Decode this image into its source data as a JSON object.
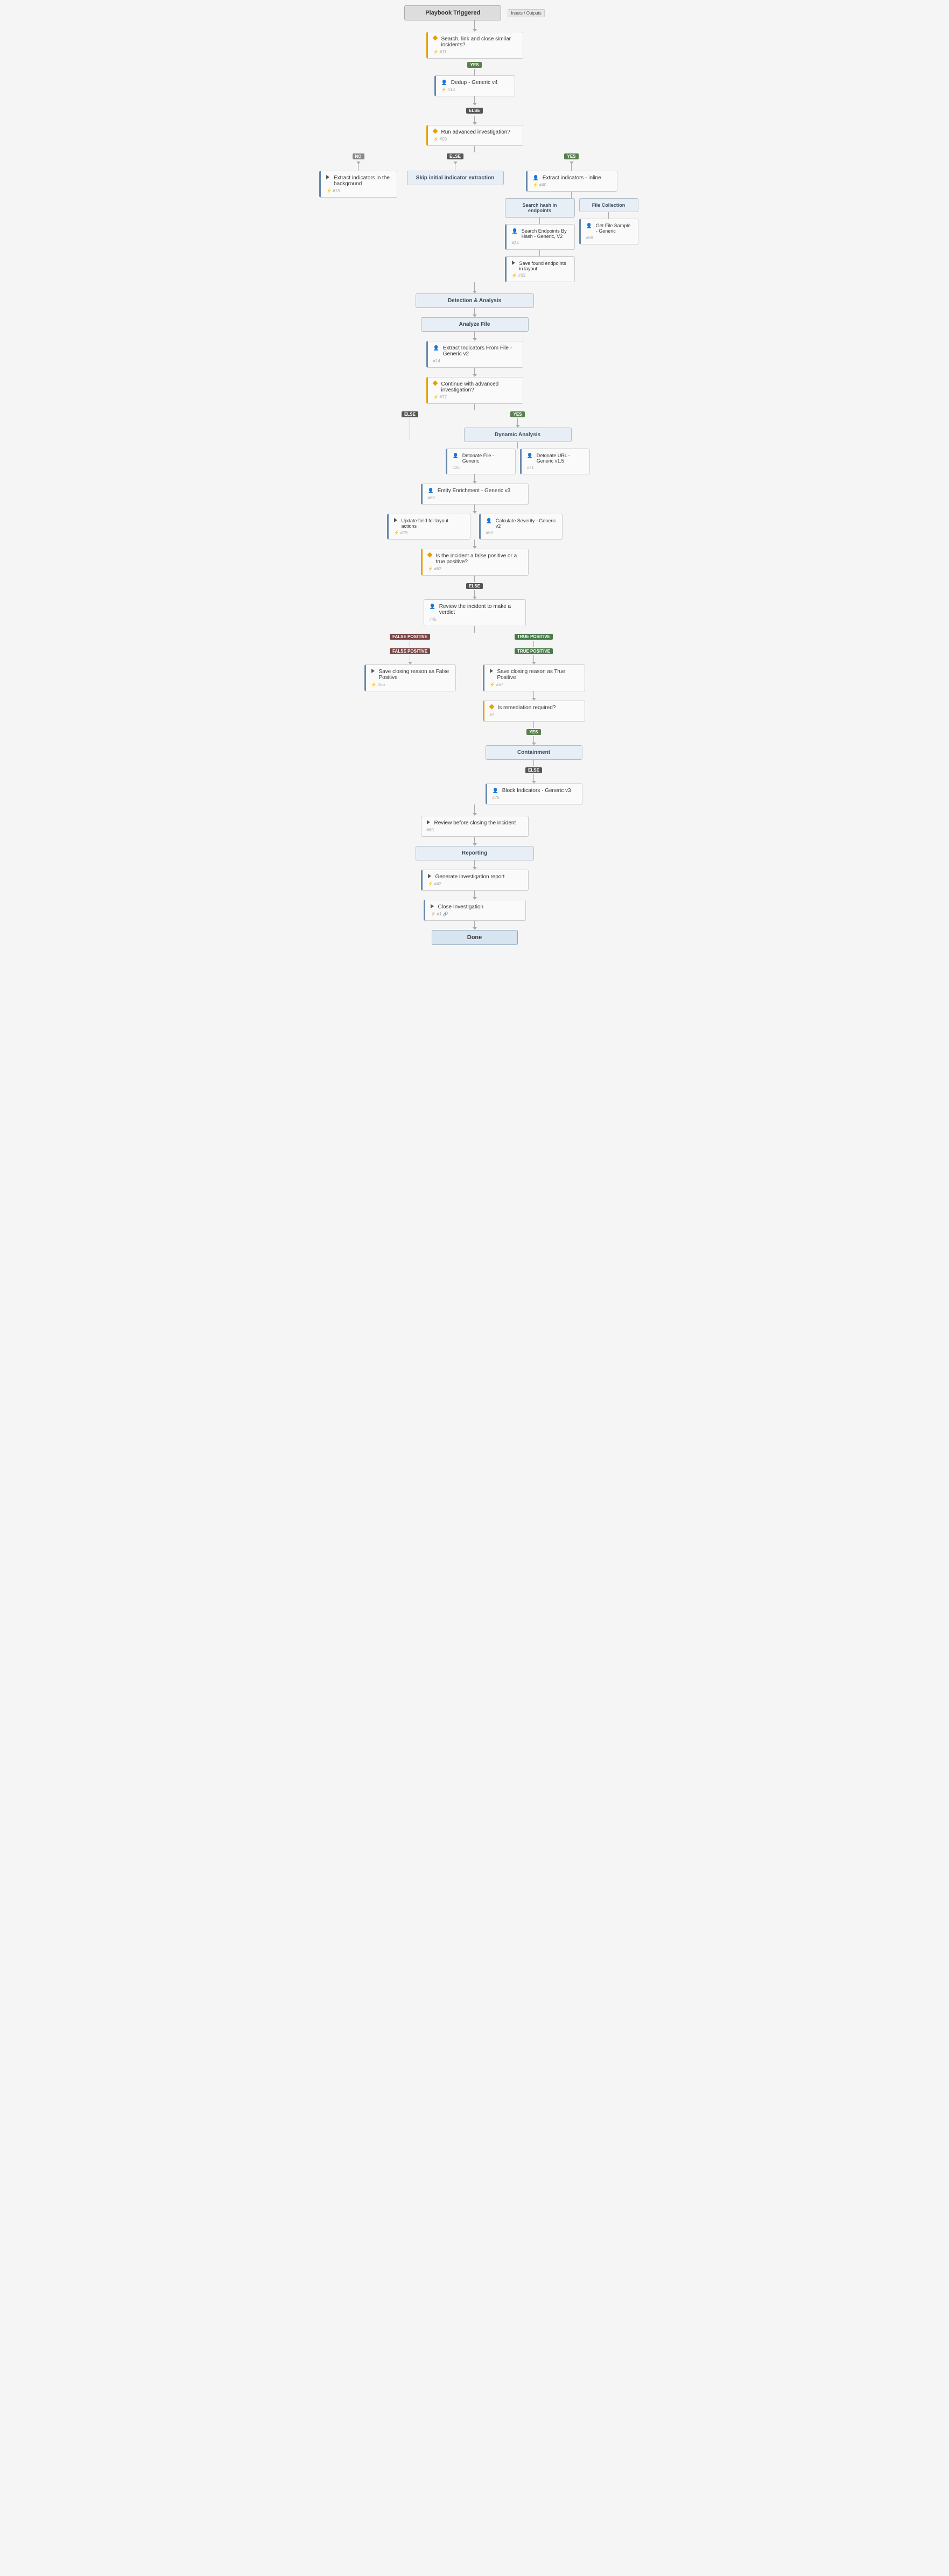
{
  "diagram": {
    "title": "Playbook Triggered",
    "io_button": "Inputs / Outputs",
    "nodes": {
      "n1": {
        "label": "Search, link and close similar incidents?",
        "id": "#11",
        "type": "condition"
      },
      "n2": {
        "label": "Dedup - Generic v4",
        "id": "#13",
        "type": "sub"
      },
      "n3": {
        "label": "Run advanced investigation?",
        "id": "#09",
        "type": "condition"
      },
      "n4": {
        "label": "Extract indicators in the background",
        "id": "#15",
        "type": "sub"
      },
      "n5": {
        "label": "Skip initial indicator extraction",
        "id": "",
        "type": "section"
      },
      "n6": {
        "label": "Extract indicators - inline",
        "id": "#40",
        "type": "sub"
      },
      "n7": {
        "label": "Search hash in endpoints",
        "type": "section"
      },
      "n8": {
        "label": "File Collection",
        "type": "section"
      },
      "n9": {
        "label": "Search Endpoints By Hash - Generic, V2",
        "id": "#34",
        "type": "sub"
      },
      "n10": {
        "label": "Get File Sample - Generic",
        "id": "#69",
        "type": "sub"
      },
      "n11": {
        "label": "Save found endpoints in layout",
        "id": "#63",
        "type": "sub"
      },
      "n12": {
        "label": "Detection & Analysis",
        "type": "section"
      },
      "n13": {
        "label": "Analyze File",
        "type": "section"
      },
      "n14": {
        "label": "Extract Indicators From File - Generic v2",
        "id": "#14",
        "type": "sub"
      },
      "n15": {
        "label": "Continue with advanced investigation?",
        "id": "#77",
        "type": "condition"
      },
      "n16": {
        "label": "Dynamic Analysis",
        "type": "section"
      },
      "n17": {
        "label": "Detonate File - Generic",
        "id": "#25",
        "type": "sub"
      },
      "n18": {
        "label": "Detonate URL - Generic v1.5",
        "id": "#71",
        "type": "sub"
      },
      "n19": {
        "label": "Entity Enrichment - Generic v3",
        "id": "#60",
        "type": "sub"
      },
      "n20": {
        "label": "Update field for layout actions",
        "id": "#79",
        "type": "sub"
      },
      "n21": {
        "label": "Calculate Severity - Generic v2",
        "id": "#62",
        "type": "sub"
      },
      "n22": {
        "label": "Is the incident a false positive or a true positive?",
        "id": "#62",
        "type": "condition"
      },
      "n23": {
        "label": "Review the incident to make a verdict",
        "id": "#45",
        "type": "task"
      },
      "n24": {
        "label": "Save closing reason as False Positive",
        "id": "#66",
        "type": "sub"
      },
      "n25": {
        "label": "Save closing reason as True Positive",
        "id": "#67",
        "type": "sub"
      },
      "n26": {
        "label": "Is remediation required?",
        "id": "#7",
        "type": "condition"
      },
      "n27": {
        "label": "Containment",
        "type": "section"
      },
      "n28": {
        "label": "Block Indicators - Generic v3",
        "id": "#76",
        "type": "sub"
      },
      "n29": {
        "label": "Review before closing the incident",
        "id": "#60",
        "type": "task"
      },
      "n30": {
        "label": "Reporting",
        "type": "section"
      },
      "n31": {
        "label": "Generate investigation report",
        "id": "#42",
        "type": "sub"
      },
      "n32": {
        "label": "Close Investigation",
        "id": "#1",
        "type": "sub"
      },
      "n33": {
        "label": "Done",
        "type": "done"
      }
    },
    "labels": {
      "yes": "YES",
      "no": "NO",
      "else": "ELSE",
      "false_positive": "FALSE POSITIVE",
      "true_positive": "TRUE POSITIVE"
    }
  }
}
